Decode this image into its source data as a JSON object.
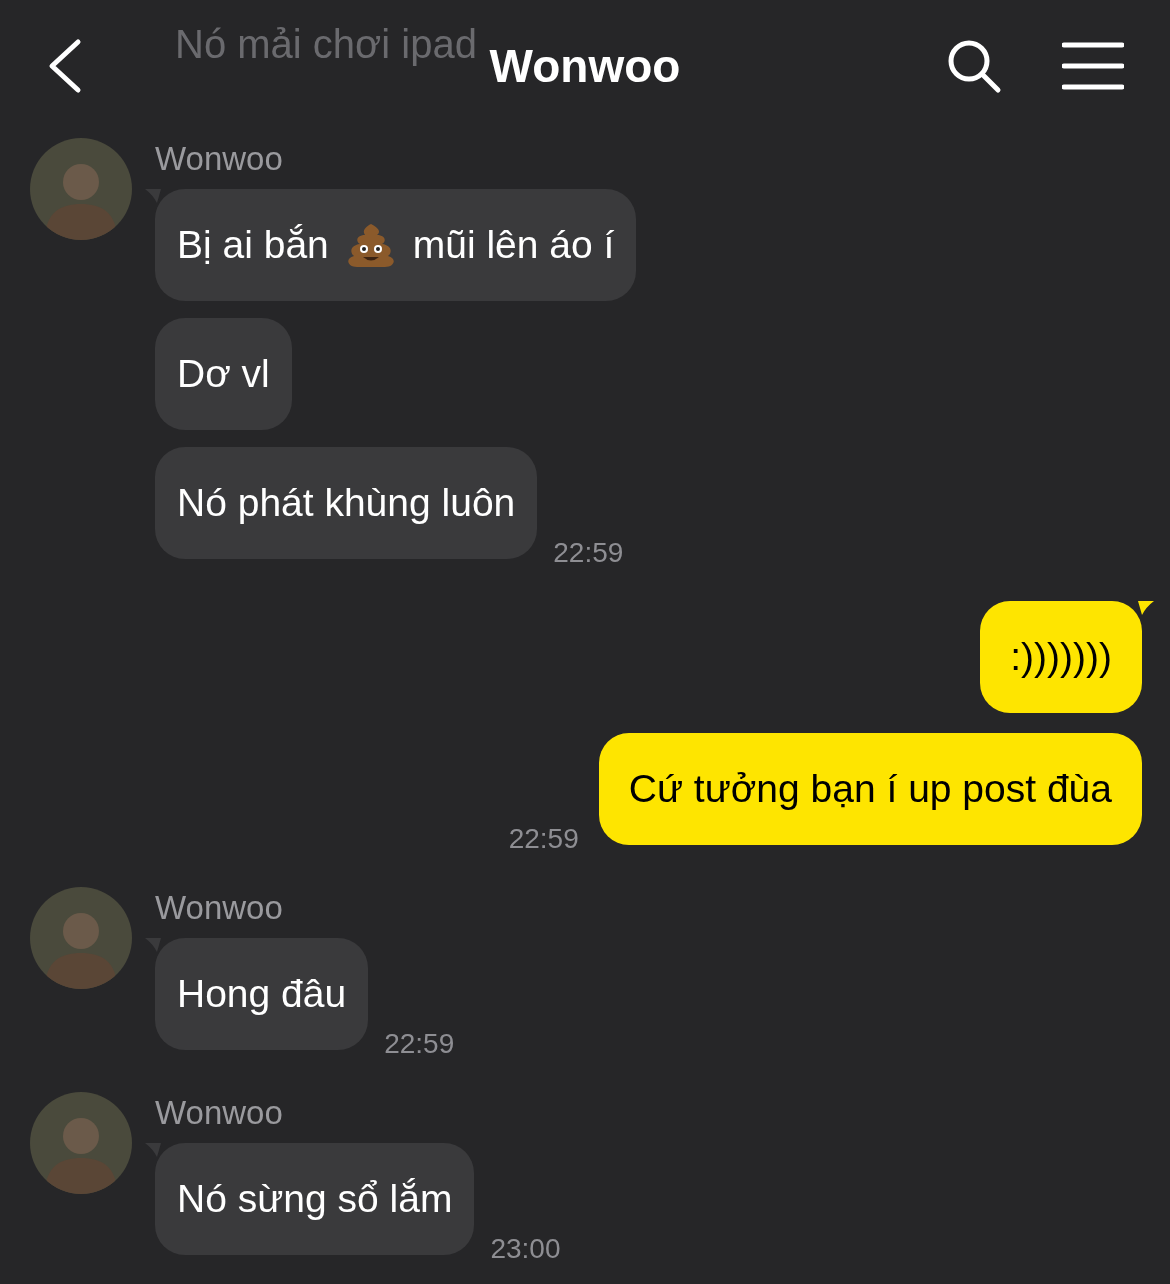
{
  "header": {
    "title": "Wonwoo"
  },
  "scrolled_message": {
    "text": "Nó mải chơi ipad"
  },
  "groups": [
    {
      "kind": "received",
      "sender": "Wonwoo",
      "bubbles": [
        {
          "parts": [
            "Bị ai bắn",
            "mũi lên áo í"
          ]
        },
        {
          "parts": [
            "Dơ vl"
          ]
        },
        {
          "parts": [
            "Nó phát khùng luôn"
          ]
        }
      ],
      "time": "22:59"
    },
    {
      "kind": "sent",
      "bubbles": [
        {
          "parts": [
            ":)))))))"
          ]
        },
        {
          "parts": [
            "Cứ tưởng bạn í up post đùa"
          ]
        }
      ],
      "time": "22:59"
    },
    {
      "kind": "received",
      "sender": "Wonwoo",
      "bubbles": [
        {
          "parts": [
            "Hong đâu"
          ]
        }
      ],
      "time": "22:59"
    },
    {
      "kind": "received",
      "sender": "Wonwoo",
      "bubbles": [
        {
          "parts": [
            "Nó sừng sổ lắm"
          ]
        }
      ],
      "time": "23:00"
    }
  ]
}
